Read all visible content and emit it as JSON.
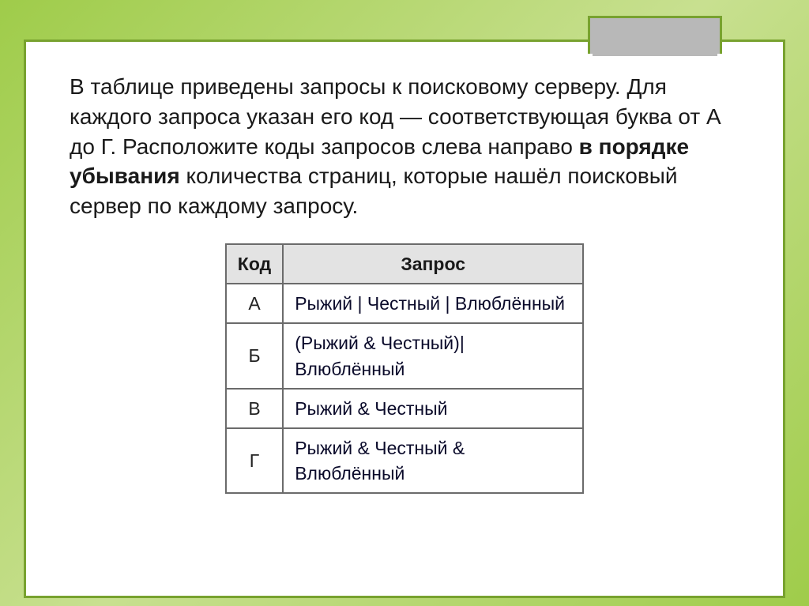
{
  "question": {
    "part1": "В таблице приведены запросы к поисковому серверу. Для каждого запроса указан его код — соответствующая буква от А до Г. Расположите коды запросов слева направо ",
    "bold1": "в порядке убывания",
    "part2": " количества страниц, которые нашёл поисковый сервер по каждому запросу."
  },
  "table": {
    "headers": {
      "code": "Код",
      "query": "Запрос"
    },
    "rows": [
      {
        "code": "А",
        "query": "Рыжий | Честный | Влюблённый"
      },
      {
        "code": "Б",
        "query": "(Рыжий & Честный)|Влюблённый"
      },
      {
        "code": "В",
        "query": "Рыжий & Честный"
      },
      {
        "code": "Г",
        "query": "Рыжий & Честный & Влюблённый"
      }
    ]
  }
}
